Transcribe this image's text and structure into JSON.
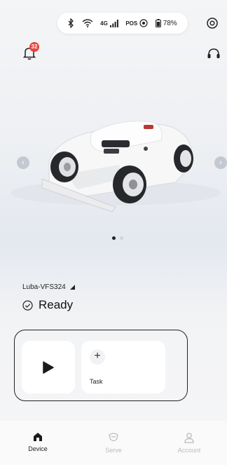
{
  "status_bar": {
    "network": "4G",
    "pos_label": "POS",
    "battery": "78%"
  },
  "notifications": {
    "count": "32"
  },
  "carousel": {
    "page_count": 2,
    "active_page": 1
  },
  "device": {
    "name": "Luba-VFS324",
    "status": "Ready"
  },
  "actions": {
    "task_label": "Task",
    "task_plus": "+"
  },
  "nav": {
    "items": [
      {
        "label": "Device",
        "icon": "home-icon",
        "active": true
      },
      {
        "label": "Serve",
        "icon": "shield-icon",
        "active": false
      },
      {
        "label": "Account",
        "icon": "user-icon",
        "active": false
      }
    ]
  },
  "colors": {
    "badge": "#e8453c",
    "inactive": "#b8bcc2",
    "text": "#222222"
  }
}
